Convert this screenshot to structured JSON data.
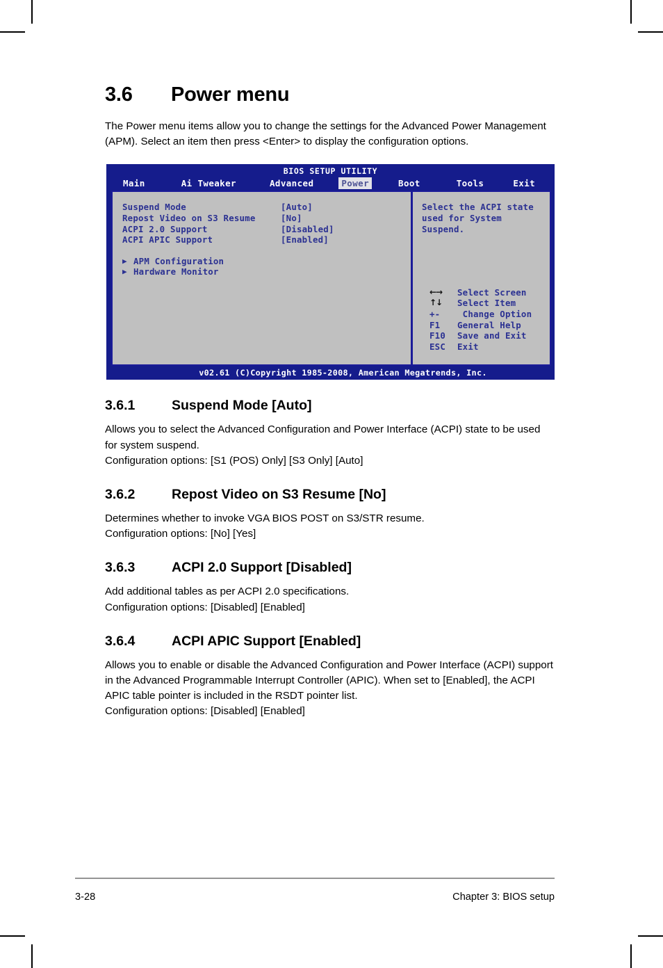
{
  "section": {
    "number": "3.6",
    "title": "Power menu",
    "intro": "The Power menu items allow you to change the settings for the Advanced Power Management (APM). Select an item then press <Enter> to display the configuration options."
  },
  "bios": {
    "title": "BIOS SETUP UTILITY",
    "tabs": [
      {
        "label": "Main",
        "selected": false
      },
      {
        "label": "Ai Tweaker",
        "selected": false
      },
      {
        "label": "Advanced",
        "selected": false
      },
      {
        "label": "Power",
        "selected": true
      },
      {
        "label": "Boot",
        "selected": false
      },
      {
        "label": "Tools",
        "selected": false
      },
      {
        "label": "Exit",
        "selected": false
      }
    ],
    "items": [
      {
        "label": "Suspend Mode",
        "value": "[Auto]"
      },
      {
        "label": "Repost Video on S3 Resume",
        "value": "[No]"
      },
      {
        "label": "ACPI 2.0 Support",
        "value": "[Disabled]"
      },
      {
        "label": "ACPI APIC Support",
        "value": "[Enabled]"
      }
    ],
    "submenus": [
      {
        "marker": "▶",
        "label": "APM Configuration"
      },
      {
        "marker": "▶",
        "label": "Hardware Monitor"
      }
    ],
    "help": "Select the ACPI state\nused for System\nSuspend.",
    "legend": [
      {
        "key": "←→",
        "glyph": true,
        "label": "Select Screen"
      },
      {
        "key": "↑↓",
        "glyph": true,
        "label": "Select Item"
      },
      {
        "key": "+-",
        "glyph": false,
        "label": " Change Option"
      },
      {
        "key": "F1",
        "glyph": false,
        "label": "General Help"
      },
      {
        "key": "F10",
        "glyph": false,
        "label": "Save and Exit"
      },
      {
        "key": "ESC",
        "glyph": false,
        "label": "Exit"
      }
    ],
    "footer": "v02.61 (C)Copyright 1985-2008, American Megatrends, Inc.",
    "colors": {
      "background": "#151c8c",
      "panel": "#c0c0c0",
      "text": "#2b3192",
      "header_text": "#ffffff",
      "selected_tab_bg": "#e2e2e8",
      "selected_tab_text": "#4d5394",
      "border": "#1b1b99"
    }
  },
  "subsections": [
    {
      "number": "3.6.1",
      "title": "Suspend Mode [Auto]",
      "body": "Allows you to select the Advanced Configuration and Power Interface (ACPI) state to be used for system suspend.",
      "options": "Configuration options: [S1 (POS) Only] [S3 Only] [Auto]"
    },
    {
      "number": "3.6.2",
      "title": "Repost Video on S3 Resume [No]",
      "body": "Determines whether to invoke VGA BIOS POST on S3/STR resume.",
      "options": "Configuration options: [No] [Yes]"
    },
    {
      "number": "3.6.3",
      "title": "ACPI 2.0 Support [Disabled]",
      "body": "Add additional tables as per ACPI 2.0 specifications.",
      "options": "Configuration options: [Disabled] [Enabled]"
    },
    {
      "number": "3.6.4",
      "title": "ACPI APIC Support [Enabled]",
      "body": "Allows you to enable or disable the Advanced Configuration and Power Interface (ACPI) support in the Advanced Programmable Interrupt Controller (APIC). When set to [Enabled], the ACPI APIC table pointer is included in the RSDT pointer list.",
      "options": "Configuration options: [Disabled] [Enabled]"
    }
  ],
  "page_footer": {
    "page_number": "3-28",
    "chapter": "Chapter 3: BIOS setup"
  }
}
